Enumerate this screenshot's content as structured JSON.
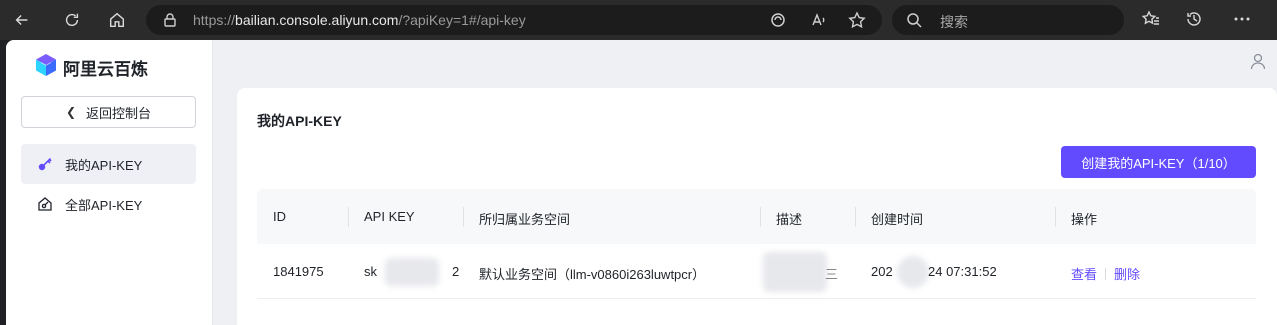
{
  "browser": {
    "url_prefix": "https://",
    "url_host": "bailian.console.aliyun.com",
    "url_path": "/?apiKey=1#/api-key",
    "search_placeholder": "搜索"
  },
  "sidebar": {
    "brand": "阿里云百炼",
    "back_label": "返回控制台",
    "items": [
      {
        "label": "我的API-KEY",
        "active": true
      },
      {
        "label": "全部API-KEY",
        "active": false
      }
    ]
  },
  "main": {
    "title": "我的API-KEY",
    "create_button": "创建我的API-KEY（1/10）",
    "table": {
      "headers": [
        "ID",
        "API KEY",
        "所归属业务空间",
        "描述",
        "创建时间",
        "操作"
      ],
      "rows": [
        {
          "id": "1841975",
          "api_key_start": "sk",
          "api_key_end": "2",
          "workspace": "默认业务空间（llm-v0860i263luwtpcr）",
          "description_tail": "三",
          "created_start": "202",
          "created_end": "24 07:31:52",
          "action_view": "查看",
          "action_delete": "删除"
        }
      ]
    }
  },
  "colors": {
    "accent": "#624aff",
    "chrome": "#2b2b2b",
    "app_bg": "#eef0f4"
  }
}
